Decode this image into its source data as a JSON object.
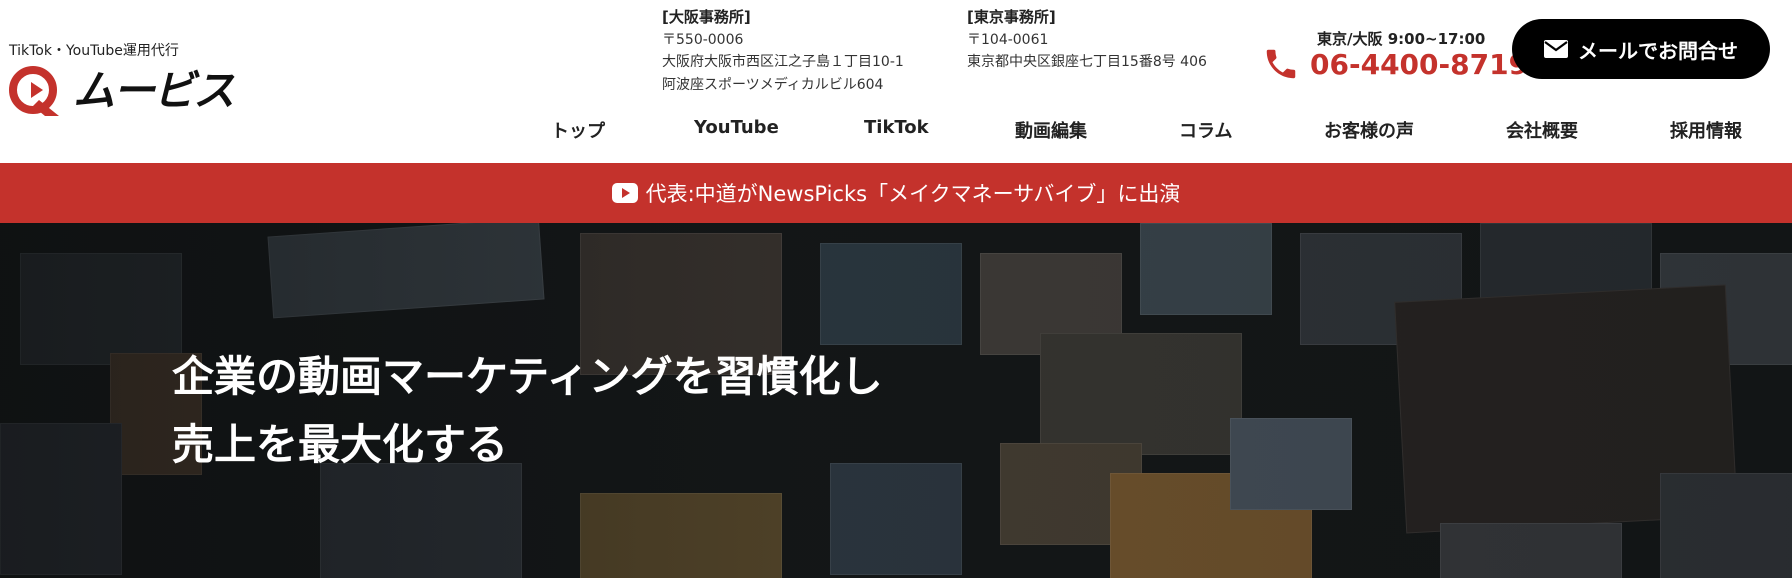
{
  "header": {
    "tagline": "TikTok・YouTube運用代行",
    "logo_text": "ムービス",
    "offices": [
      {
        "title": "[大阪事務所]",
        "zip": "〒550-0006",
        "address1": "大阪府大阪市西区江之子島１丁目10-1",
        "address2": "阿波座スポーツメディカルビル604"
      },
      {
        "title": "[東京事務所]",
        "zip": "〒104-0061",
        "address1": "東京都中央区銀座七丁目15番8号 406"
      }
    ],
    "contact": {
      "hours": "東京/大阪 9:00~17:00",
      "phone": "06-4400-8719"
    },
    "mail_button": "メールでお問合せ"
  },
  "nav": [
    {
      "label": "トップ"
    },
    {
      "label": "YouTube"
    },
    {
      "label": "TikTok"
    },
    {
      "label": "動画編集"
    },
    {
      "label": "コラム"
    },
    {
      "label": "お客様の声"
    },
    {
      "label": "会社概要"
    },
    {
      "label": "採用情報"
    }
  ],
  "banner": {
    "text": "代表:中道がNewsPicks「メイクマネーサバイブ」に出演"
  },
  "hero": {
    "line1": "企業の動画マーケティングを習慣化し",
    "line2": "売上を最大化する"
  },
  "colors": {
    "accent": "#c4322c",
    "button": "#000000",
    "hero_bg": "#151819"
  },
  "icons": {
    "logo": "play-q-logo-icon",
    "phone": "phone-icon",
    "mail": "mail-icon",
    "youtube": "youtube-icon"
  }
}
